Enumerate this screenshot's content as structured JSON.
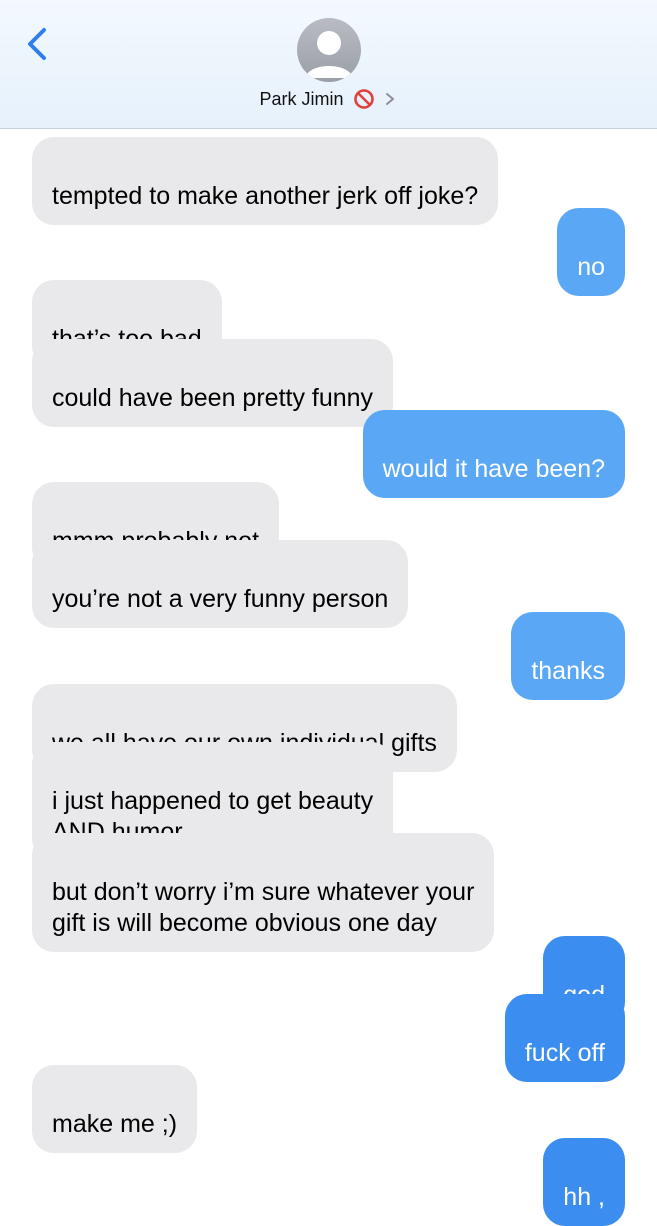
{
  "header": {
    "contact_name": "Park Jimin",
    "blocked_icon": "prohibited-icon",
    "chevron_icon": "chevron-right-icon",
    "back_icon": "chevron-left-icon",
    "avatar_icon": "person-silhouette-icon"
  },
  "colors": {
    "incoming_bubble": "#e9e9eb",
    "outgoing_bubble": "#3b8ef0",
    "accent": "#2f80ed",
    "blocked": "#e0413b"
  },
  "messages": [
    {
      "dir": "in",
      "text": "tempted to make another jerk off joke?"
    },
    {
      "dir": "out",
      "text": "no"
    },
    {
      "dir": "in",
      "text": "that’s too bad"
    },
    {
      "dir": "in",
      "text": "could have been pretty funny"
    },
    {
      "dir": "out",
      "text": "would it have been?"
    },
    {
      "dir": "in",
      "text": "mmm probably not"
    },
    {
      "dir": "in",
      "text": "you’re not a very funny person"
    },
    {
      "dir": "out",
      "text": "thanks"
    },
    {
      "dir": "in",
      "text": "we all have our own individual gifts"
    },
    {
      "dir": "in",
      "text": "i just happened to get beauty\nAND humor"
    },
    {
      "dir": "in",
      "text": "but don’t worry i’m sure whatever your\ngift is will become obvious one day"
    },
    {
      "dir": "out",
      "text": "god"
    },
    {
      "dir": "out",
      "text": "fuck off"
    },
    {
      "dir": "in",
      "text": "make me ;)"
    },
    {
      "dir": "out",
      "text": "hh ,"
    }
  ]
}
